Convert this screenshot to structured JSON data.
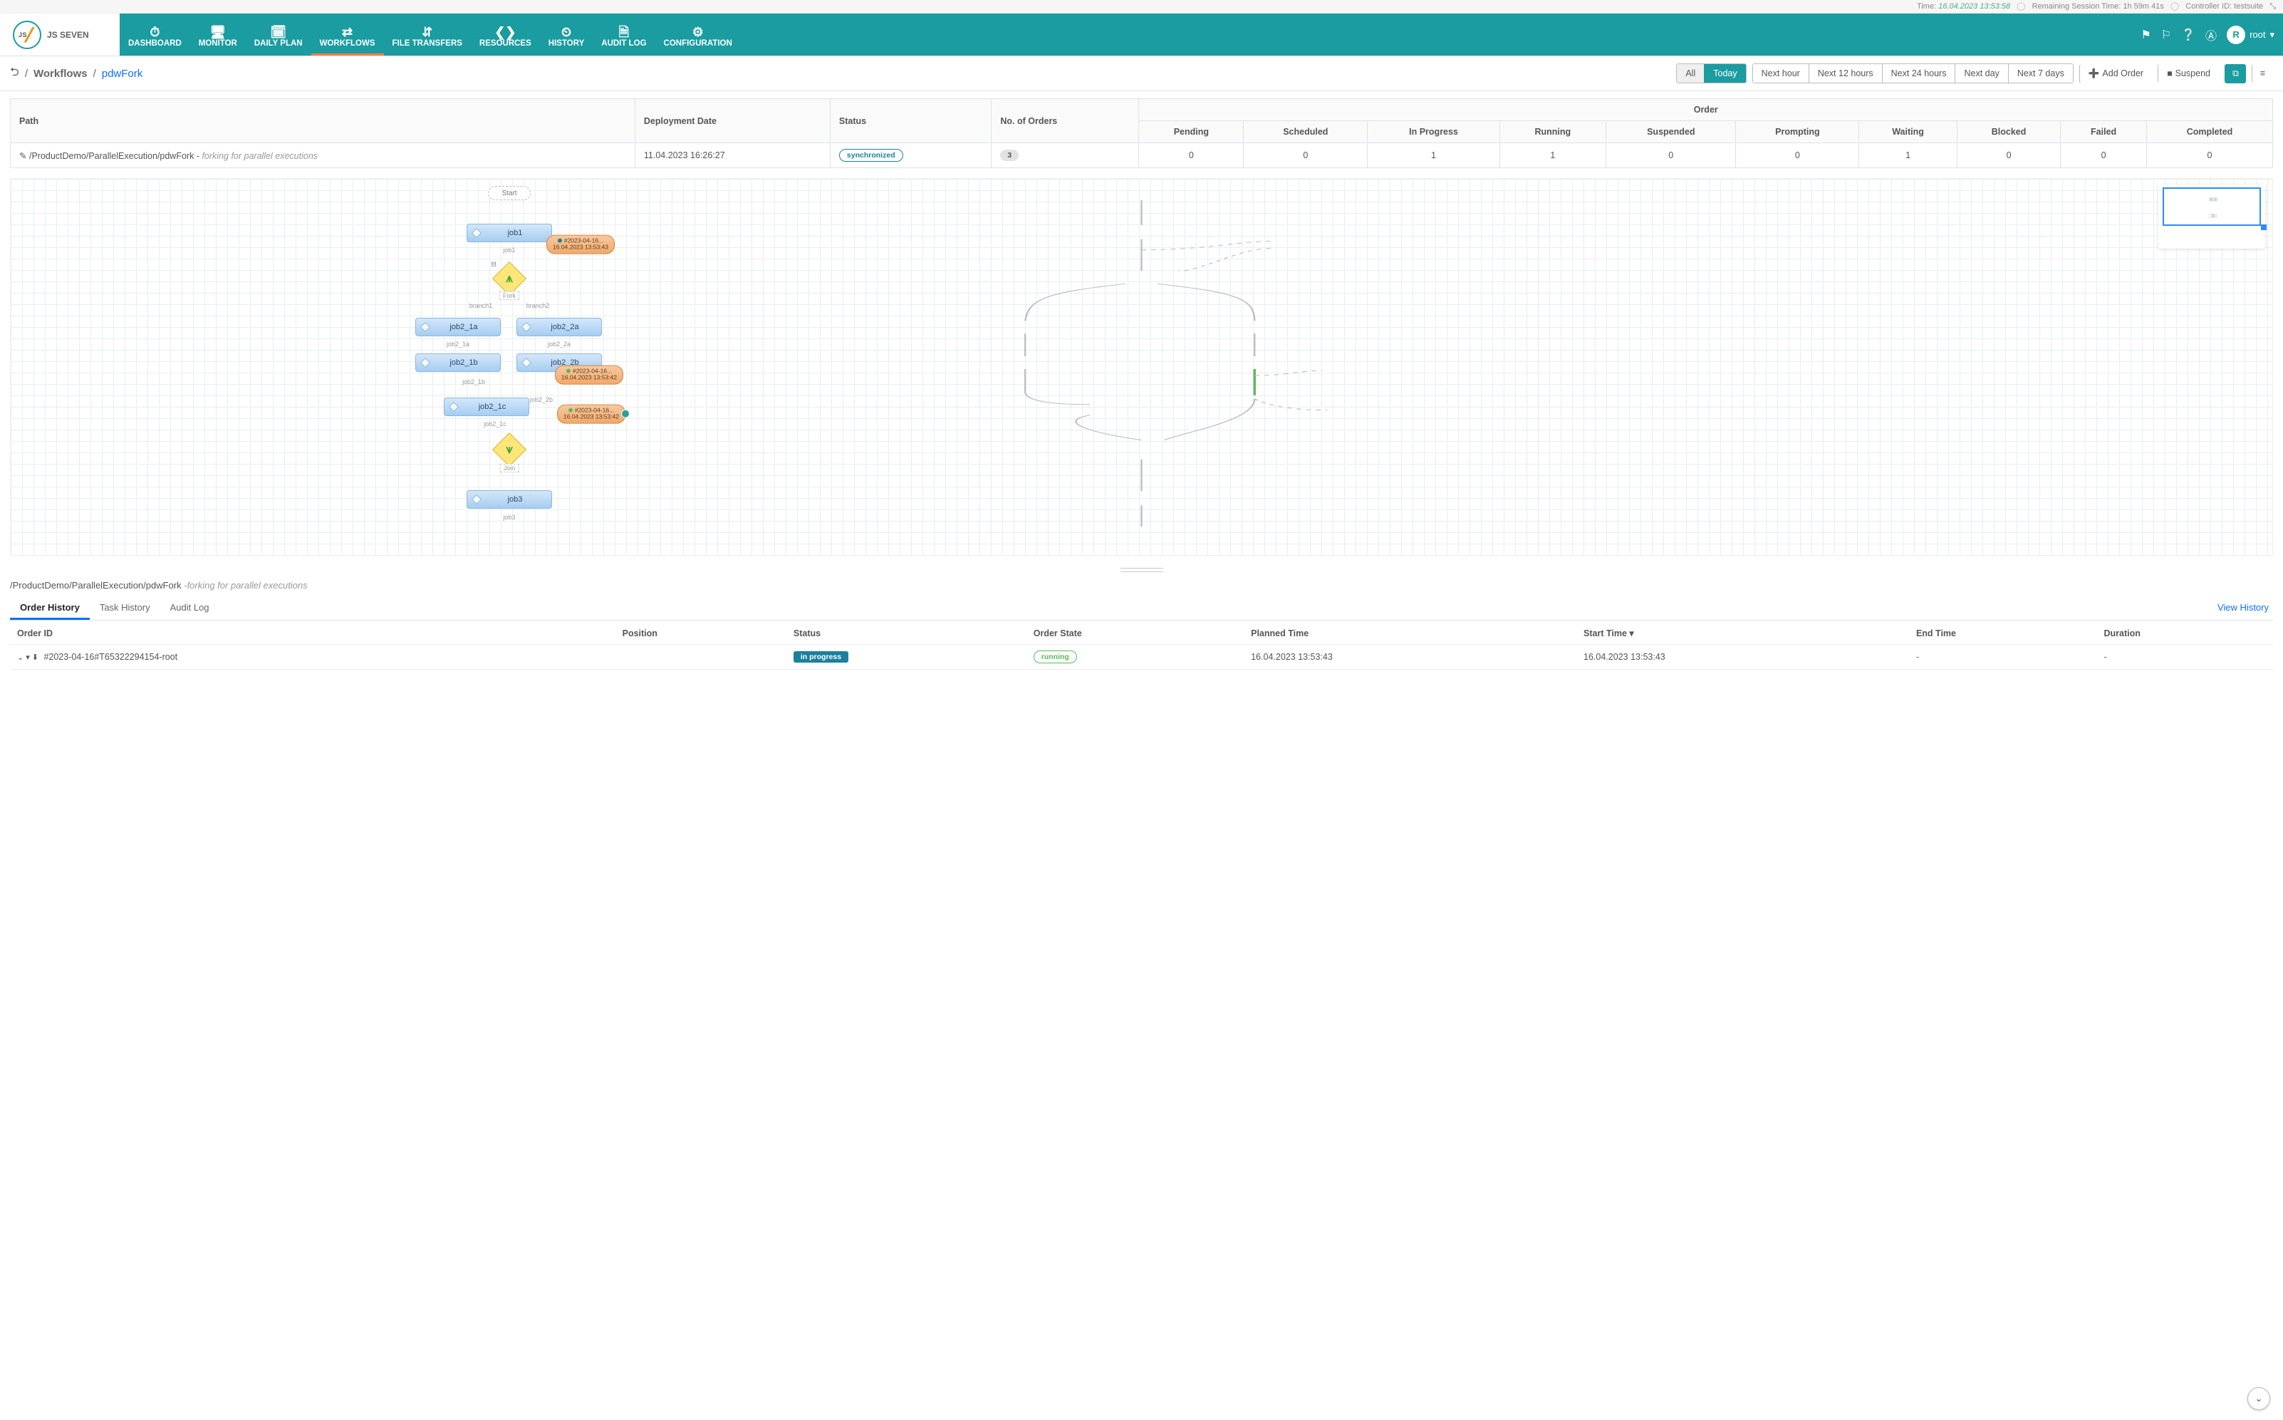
{
  "meta": {
    "time_label": "Time:",
    "time_value": "16.04.2023 13:53:58",
    "session_label": "Remaining Session Time:",
    "session_value": "1h 59m 41s",
    "controller_label": "Controller ID:",
    "controller_value": "testsuite"
  },
  "logo": {
    "text_small": "JS",
    "text": "JS SEVEN"
  },
  "nav": [
    {
      "label": "DASHBOARD",
      "icon": "⏱"
    },
    {
      "label": "MONITOR",
      "icon": "🖥"
    },
    {
      "label": "DAILY PLAN",
      "icon": "🗓"
    },
    {
      "label": "WORKFLOWS",
      "icon": "⇄",
      "active": true
    },
    {
      "label": "FILE TRANSFERS",
      "icon": "⇵"
    },
    {
      "label": "RESOURCES",
      "icon": "❮❯"
    },
    {
      "label": "HISTORY",
      "icon": "⏲"
    },
    {
      "label": "AUDIT LOG",
      "icon": "🗎"
    },
    {
      "label": "CONFIGURATION",
      "icon": "⚙"
    }
  ],
  "user": {
    "initial": "R",
    "name": "root"
  },
  "breadcrumb": {
    "level1": "Workflows",
    "level2": "pdwFork"
  },
  "ranges": {
    "all": "All",
    "periods": [
      "Today",
      "Next hour",
      "Next 12 hours",
      "Next 24 hours",
      "Next day",
      "Next 7 days"
    ],
    "active": "Today",
    "add_order": "Add Order",
    "suspend": "Suspend"
  },
  "summary": {
    "cols": {
      "path": "Path",
      "deploy": "Deployment Date",
      "status": "Status",
      "num": "No. of Orders",
      "order_group": "Order",
      "order_cols": [
        "Pending",
        "Scheduled",
        "In Progress",
        "Running",
        "Suspended",
        "Prompting",
        "Waiting",
        "Blocked",
        "Failed",
        "Completed"
      ]
    },
    "row": {
      "path": "/ProductDemo/ParallelExecution/pdwFork",
      "note": "forking for parallel executions",
      "deploy": "11.04.2023 16:26:27",
      "status": "synchronized",
      "num": "3",
      "counts": [
        "0",
        "0",
        "1",
        "1",
        "0",
        "0",
        "1",
        "0",
        "0",
        "0"
      ]
    }
  },
  "diagram": {
    "start": "Start",
    "job1": "job1",
    "job1_edge": "job1",
    "fork_label": "Fork",
    "branch1": "branch1",
    "branch2": "branch2",
    "job2_1a": "job2_1a",
    "job2_2a": "job2_2a",
    "job2_1b": "job2_1b",
    "job2_2b": "job2_2b",
    "job2_1c": "job2_1c",
    "e_job2_1a": "job2_1a",
    "e_job2_2a": "job2_2a",
    "e_job2_1b": "job2_1b",
    "e_job2_2b": "job2_2b",
    "e_job2_1c": "job2_1c",
    "join_label": "Join",
    "job3": "job3",
    "e_job3": "job3",
    "order_date": "#2023-04-16",
    "order_time": "16.04.2023 13:53:43",
    "order_time2": "16.04.2023 13:53:42"
  },
  "detail": {
    "path": "/ProductDemo/ParallelExecution/pdwFork",
    "note": "-forking for parallel executions",
    "tabs": [
      "Order History",
      "Task History",
      "Audit Log"
    ],
    "active_tab": "Order History",
    "view_history": "View History",
    "cols": {
      "order_id": "Order ID",
      "position": "Position",
      "status": "Status",
      "state": "Order State",
      "planned": "Planned Time",
      "start": "Start Time",
      "end": "End Time",
      "duration": "Duration"
    },
    "row": {
      "order_id": "#2023-04-16#T65322294154-root",
      "position": "",
      "status": "in progress",
      "state": "running",
      "planned": "16.04.2023 13:53:43",
      "start": "16.04.2023 13:53:43",
      "end": "-",
      "duration": "-"
    }
  }
}
